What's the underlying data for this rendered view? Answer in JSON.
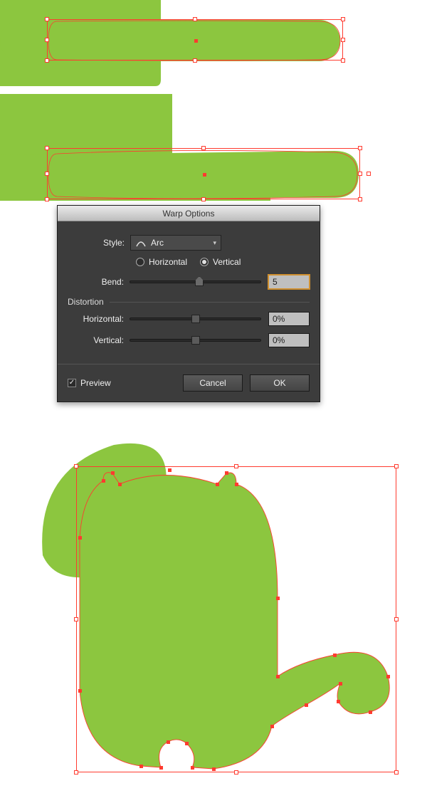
{
  "dialog": {
    "title": "Warp Options",
    "style_label": "Style:",
    "style_value": "Arc",
    "orient_h": "Horizontal",
    "orient_v": "Vertical",
    "orient_selected": "vertical",
    "bend_label": "Bend:",
    "bend_value": "5",
    "distortion_header": "Distortion",
    "dist_h_label": "Horizontal:",
    "dist_h_value": "0%",
    "dist_v_label": "Vertical:",
    "dist_v_value": "0%",
    "preview_label": "Preview",
    "preview_checked": true,
    "cancel_label": "Cancel",
    "ok_label": "OK"
  },
  "colors": {
    "shape_fill": "#8cc63f",
    "selection": "#ff3b2f"
  }
}
